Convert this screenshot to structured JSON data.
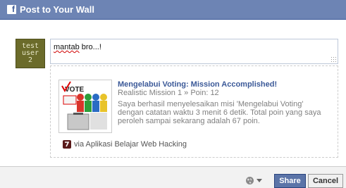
{
  "dialog": {
    "logo_letter": "f",
    "title": "Post to Your Wall"
  },
  "avatar": {
    "lines": [
      "test",
      "user",
      "2"
    ]
  },
  "message": {
    "misspelled_word": "mantab",
    "rest": " bro...!"
  },
  "attachment": {
    "title": "Mengelabui Voting: Mission Accomplished!",
    "subtitle": "Realistic Mission 1 » Poin: 12",
    "description": "Saya berhasil menyelesaikan misi 'Mengelabui Voting' dengan catatan waktu 3 menit 6 detik. Total poin yang saya peroleh sampai sekarang adalah 67 poin.",
    "thumb_vote_text": "VOTE",
    "via_text": "via Aplikasi Belajar Web Hacking"
  },
  "footer": {
    "share_label": "Share",
    "cancel_label": "Cancel"
  },
  "colors": {
    "header_bg": "#6d84b4",
    "link_blue": "#3b5998",
    "share_bg": "#5b74a8"
  },
  "icons": {
    "privacy": "globe-icon",
    "dropdown": "chevron-down-icon",
    "app": "app-icon"
  }
}
